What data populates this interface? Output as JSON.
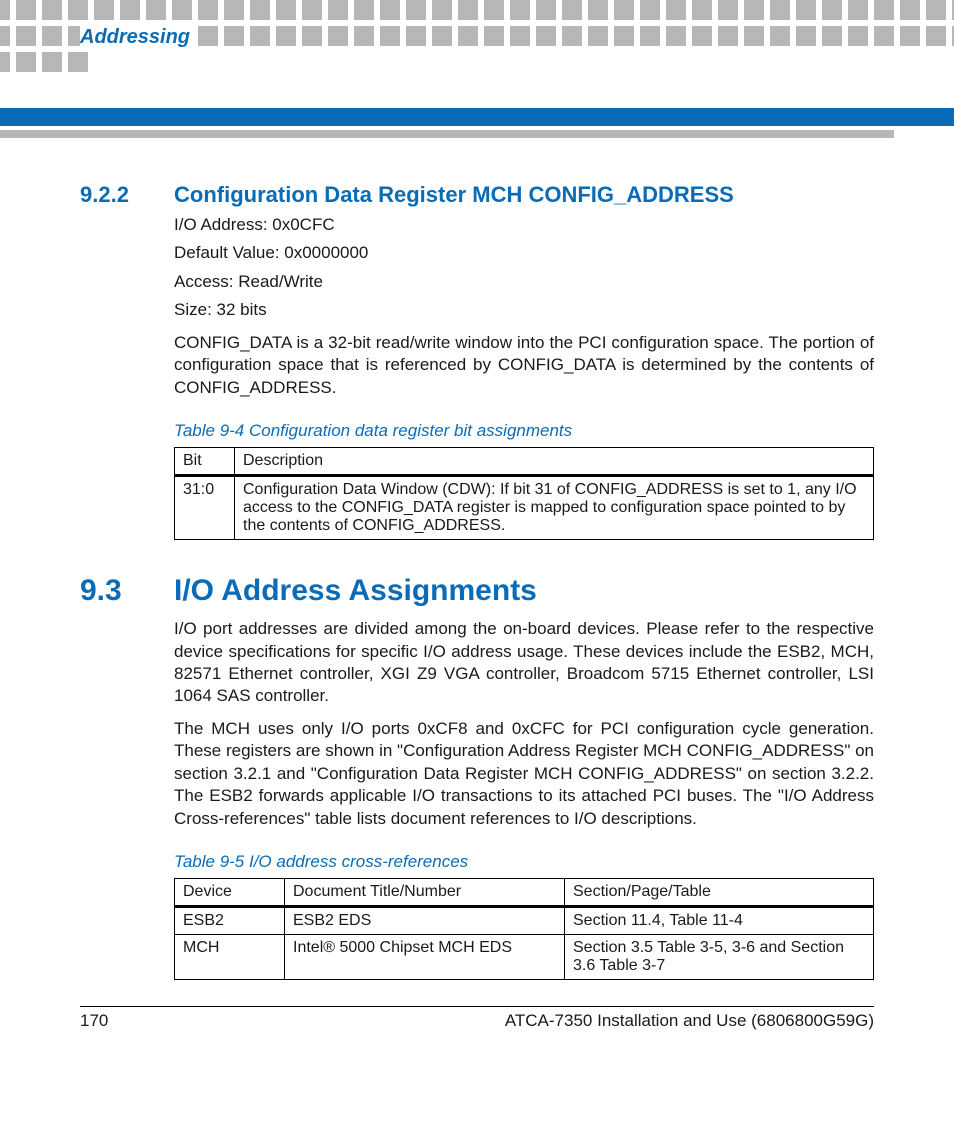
{
  "header": {
    "chapter": "Addressing"
  },
  "section922": {
    "num": "9.2.2",
    "title": "Configuration Data Register MCH CONFIG_ADDRESS",
    "io_address": "I/O Address: 0x0CFC",
    "default_value": "Default Value: 0x0000000",
    "access": "Access: Read/Write",
    "size": "Size: 32 bits",
    "para": "CONFIG_DATA is a 32-bit read/write window into the PCI configuration space. The portion of configuration space that is referenced by CONFIG_DATA is determined by the contents of CONFIG_ADDRESS."
  },
  "table94": {
    "caption": "Table 9-4 Configuration data register bit assignments",
    "headers": [
      "Bit",
      "Description"
    ],
    "row": {
      "bit": "31:0",
      "desc": "Configuration Data Window (CDW): If bit 31 of CONFIG_ADDRESS is set to 1, any I/O access to the CONFIG_DATA register is mapped to configuration space pointed to by the contents of CONFIG_ADDRESS."
    }
  },
  "section93": {
    "num": "9.3",
    "title": "I/O Address Assignments",
    "para1": "I/O port addresses are divided among the on-board devices. Please refer to the respective device specifications for specific I/O address usage. These devices include the ESB2, MCH, 82571 Ethernet controller, XGI Z9 VGA controller, Broadcom 5715 Ethernet controller, LSI 1064 SAS controller.",
    "para2": "The MCH uses only I/O ports 0xCF8 and 0xCFC for PCI configuration cycle generation. These registers are shown in \"Configuration Address Register MCH CONFIG_ADDRESS\" on section 3.2.1 and \"Configuration Data Register MCH CONFIG_ADDRESS\" on section 3.2.2. The ESB2 forwards applicable I/O transactions to its attached PCI buses. The \"I/O Address Cross-references\" table lists document references to I/O descriptions."
  },
  "table95": {
    "caption": "Table 9-5 I/O address cross-references",
    "headers": [
      "Device",
      "Document Title/Number",
      "Section/Page/Table"
    ],
    "rows": [
      {
        "device": "ESB2",
        "doc": "ESB2 EDS",
        "sec": "Section 11.4, Table 11-4"
      },
      {
        "device": "MCH",
        "doc": "Intel® 5000 Chipset MCH EDS",
        "sec": "Section 3.5 Table 3-5, 3-6 and Section 3.6 Table 3-7"
      }
    ]
  },
  "footer": {
    "page": "170",
    "doc": "ATCA-7350 Installation and Use (6806800G59G)"
  }
}
